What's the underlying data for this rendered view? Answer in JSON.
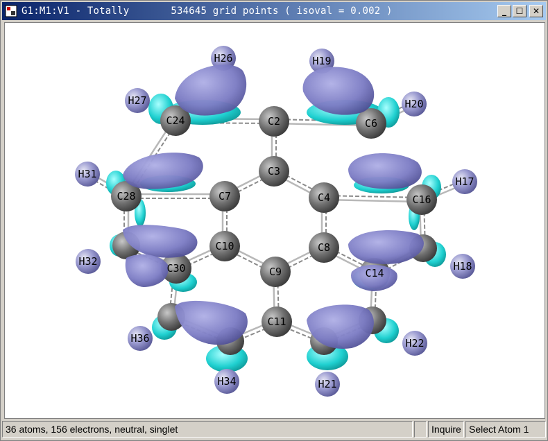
{
  "window": {
    "title": "G1:M1:V1 - Totally",
    "grid_info": "534645 grid points ( isoval = 0.002 )",
    "buttons": {
      "minimize": "_",
      "maximize": "☐",
      "close": "✕"
    }
  },
  "colors": {
    "isosurface_positive": "#7b7bc8",
    "isosurface_negative": "#1fd6d6",
    "carbon": "#6e6e6e",
    "hydrogen_tint": "#8585c8",
    "title_bar": "#0a246a"
  },
  "atoms": {
    "carbon": [
      {
        "label": "C2"
      },
      {
        "label": "C3"
      },
      {
        "label": "C4"
      },
      {
        "label": "C6"
      },
      {
        "label": "C7"
      },
      {
        "label": "C8"
      },
      {
        "label": "C9"
      },
      {
        "label": "C10"
      },
      {
        "label": "C11"
      },
      {
        "label": "C14"
      },
      {
        "label": "C16"
      },
      {
        "label": "C24"
      },
      {
        "label": "C28"
      },
      {
        "label": "C30"
      }
    ],
    "hydrogen": [
      {
        "label": "H17"
      },
      {
        "label": "H18"
      },
      {
        "label": "H19"
      },
      {
        "label": "H20"
      },
      {
        "label": "H21"
      },
      {
        "label": "H22"
      },
      {
        "label": "H26"
      },
      {
        "label": "H27"
      },
      {
        "label": "H31"
      },
      {
        "label": "H32"
      },
      {
        "label": "H34"
      },
      {
        "label": "H36"
      }
    ]
  },
  "status": {
    "info": "36 atoms, 156 electrons, neutral, singlet",
    "mode": "Inquire",
    "action": "Select Atom 1"
  }
}
